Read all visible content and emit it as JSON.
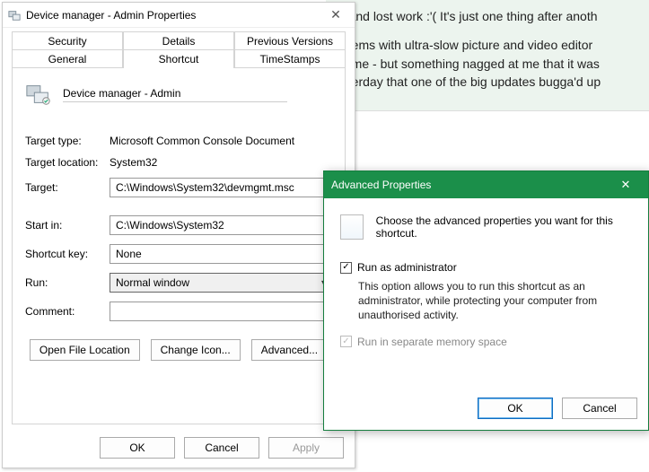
{
  "bg": {
    "line1": "ot and lost work :'( It's just one thing after anoth",
    "line2": "oblems with ultra-slow picture and video editor",
    "line3": "d time - but something nagged at me that it was",
    "line4": "esterday that one of the big updates bugga'd up"
  },
  "props": {
    "title": "Device manager - Admin Properties",
    "tabs": {
      "security": "Security",
      "details": "Details",
      "previous": "Previous Versions",
      "general": "General",
      "shortcut": "Shortcut",
      "timestamps": "TimeStamps"
    },
    "header_caption": "Device manager - Admin",
    "labels": {
      "target_type": "Target type:",
      "target_location": "Target location:",
      "target": "Target:",
      "start_in": "Start in:",
      "shortcut_key": "Shortcut key:",
      "run": "Run:",
      "comment": "Comment:"
    },
    "values": {
      "target_type": "Microsoft Common Console Document",
      "target_location": "System32",
      "target": "C:\\Windows\\System32\\devmgmt.msc",
      "start_in": "C:\\Windows\\System32",
      "shortcut_key": "None",
      "run": "Normal window",
      "comment": ""
    },
    "buttons": {
      "open_loc": "Open File Location",
      "change_icon": "Change Icon...",
      "advanced": "Advanced...",
      "ok": "OK",
      "cancel": "Cancel",
      "apply": "Apply"
    }
  },
  "adv": {
    "title": "Advanced Properties",
    "lead": "Choose the advanced properties you want for this shortcut.",
    "run_admin_label": "Run as administrator",
    "run_admin_desc": "This option allows you to run this shortcut as an administrator, while protecting your computer from unauthorised activity.",
    "sep_mem_label": "Run in separate memory space",
    "ok": "OK",
    "cancel": "Cancel"
  }
}
